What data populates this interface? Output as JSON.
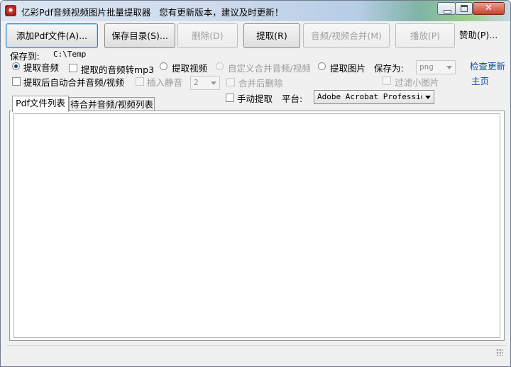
{
  "window": {
    "title": "亿彩Pdf音频视频图片批量提取器",
    "update_notice": "您有更新版本，建议及时更新！",
    "close_glyph": "✕"
  },
  "toolbar": {
    "add_pdf": "添加Pdf文件(A)...",
    "save_dir": "保存目录(S)...",
    "delete": "删除(D)",
    "extract": "提取(R)",
    "merge": "音频/视频合并(M)",
    "play": "播放(P)",
    "help": "赞助(P)..."
  },
  "options": {
    "save_to_label": "保存到:",
    "save_to_path": "C:\\Temp",
    "extract_audio": "提取音频",
    "audio_to_mp3": "提取的音频转mp3",
    "extract_video": "提取视频",
    "custom_merge": "自定义合并音频/视频",
    "extract_image": "提取图片",
    "save_as_label": "保存为:",
    "save_as_value": "png",
    "check_update": "检查更新",
    "auto_merge": "提取后自动合并音频/视频",
    "insert_silence": "插入静音",
    "silence_value": "2",
    "delete_after_merge": "合并后删除",
    "filter_small": "过滤小图片",
    "homepage": "主页",
    "manual_extract": "手动提取",
    "platform_label": "平台:",
    "platform_value": "Adobe Acrobat Professional"
  },
  "tabs": {
    "pdf_list": "Pdf文件列表",
    "merge_list": "待合并音频/视频列表"
  },
  "colors": {
    "link": "#0b4fb0",
    "title_gradient_end": "#9ccf8c"
  }
}
